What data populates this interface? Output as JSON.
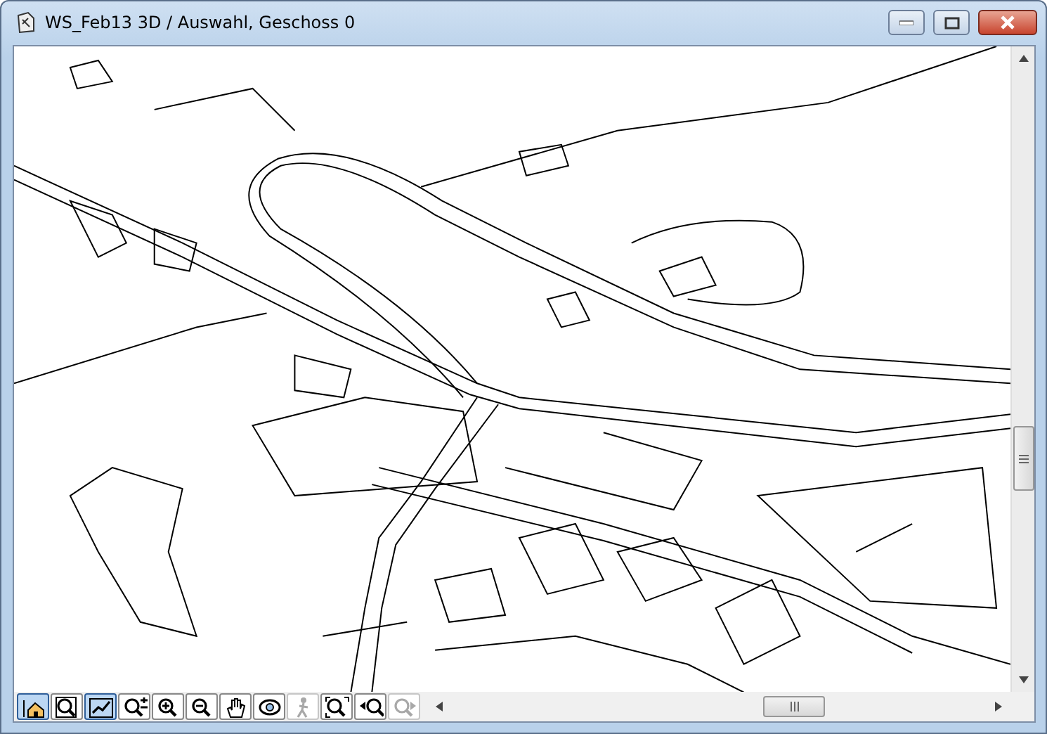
{
  "window": {
    "title": "WS_Feb13 3D / Auswahl, Geschoss 0"
  },
  "toolbar": [
    {
      "kind": "house",
      "selected": true,
      "disabled": false
    },
    {
      "kind": "zoom-frame",
      "selected": false,
      "disabled": false
    },
    {
      "kind": "chart",
      "selected": true,
      "disabled": false
    },
    {
      "kind": "zoom-plus-minus",
      "selected": false,
      "disabled": false
    },
    {
      "kind": "zoom-in",
      "selected": false,
      "disabled": false
    },
    {
      "kind": "zoom-out",
      "selected": false,
      "disabled": false
    },
    {
      "kind": "hand",
      "selected": false,
      "disabled": false
    },
    {
      "kind": "orbit",
      "selected": false,
      "disabled": false
    },
    {
      "kind": "walk",
      "selected": false,
      "disabled": true
    },
    {
      "kind": "zoom-fit",
      "selected": false,
      "disabled": false
    },
    {
      "kind": "zoom-back",
      "selected": false,
      "disabled": false
    },
    {
      "kind": "zoom-forward",
      "selected": false,
      "disabled": true
    }
  ]
}
